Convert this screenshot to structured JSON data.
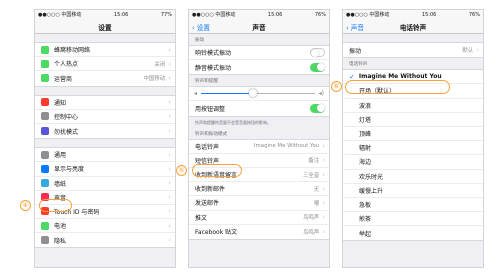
{
  "status": {
    "carrier": "●●○○○ 中国移动",
    "time": "15:06",
    "battery_a": "77%",
    "battery_b": "76%"
  },
  "screen1": {
    "title": "设置",
    "group1": [
      {
        "label": "蜂窝移动网络",
        "value": "",
        "icon": "cellular-icon",
        "color": "#4cd964"
      },
      {
        "label": "个人热点",
        "value": "关闭",
        "icon": "hotspot-icon",
        "color": "#4cd964"
      },
      {
        "label": "运营商",
        "value": "中国移动",
        "icon": "carrier-icon",
        "color": "#4cd964"
      }
    ],
    "group2": [
      {
        "label": "通知",
        "icon": "notifications-icon",
        "color": "#ff3b30"
      },
      {
        "label": "控制中心",
        "icon": "control-center-icon",
        "color": "#8e8e93"
      },
      {
        "label": "勿扰模式",
        "icon": "do-not-disturb-icon",
        "color": "#5856d6"
      }
    ],
    "group3": [
      {
        "label": "通用",
        "icon": "general-icon",
        "color": "#8e8e93"
      },
      {
        "label": "显示与亮度",
        "icon": "display-icon",
        "color": "#0a7aff"
      },
      {
        "label": "墙纸",
        "icon": "wallpaper-icon",
        "color": "#34aadc"
      },
      {
        "label": "声音",
        "icon": "sounds-icon",
        "color": "#ff2d55"
      },
      {
        "label": "Touch ID 与密码",
        "icon": "touch-id-icon",
        "color": "#ff3b30"
      },
      {
        "label": "电池",
        "icon": "battery-icon",
        "color": "#4cd964"
      },
      {
        "label": "隐私",
        "icon": "privacy-icon",
        "color": "#8e8e93"
      }
    ]
  },
  "screen2": {
    "back": "设置",
    "title": "声音",
    "vibrate_header": "振动",
    "vibrate": [
      "响铃模式振动",
      "静音模式振动"
    ],
    "ringer_header": "铃声和提醒",
    "adjust_label": "用按钮调整",
    "adjust_note": "铃声和提醒的音量不会受音量按钮的影响。",
    "patterns_header": "铃声和振动模式",
    "tones": [
      {
        "label": "电话铃声",
        "value": "Imagine Me Without You"
      },
      {
        "label": "短信铃声",
        "value": "备注"
      },
      {
        "label": "收到新语音留言",
        "value": "三全音"
      },
      {
        "label": "收到新邮件",
        "value": "无"
      },
      {
        "label": "发送邮件",
        "value": "嗖"
      },
      {
        "label": "推文",
        "value": "鸟鸣声"
      },
      {
        "label": "Facebook 贴文",
        "value": "鸟鸣声"
      }
    ]
  },
  "screen3": {
    "back": "声音",
    "title": "电话铃声",
    "vibration_label": "振动",
    "vibration_value": "默认",
    "ringtones_header": "电话铃声",
    "selected": "Imagine Me Without You",
    "tones": [
      "开场（默认）",
      "波浪",
      "灯塔",
      "顶峰",
      "辐射",
      "海边",
      "欢乐时光",
      "缓慢上升",
      "急板",
      "煎茶",
      "举起"
    ]
  },
  "callouts": [
    "④",
    "⑤",
    "⑥"
  ],
  "accent": "#f7a23a"
}
